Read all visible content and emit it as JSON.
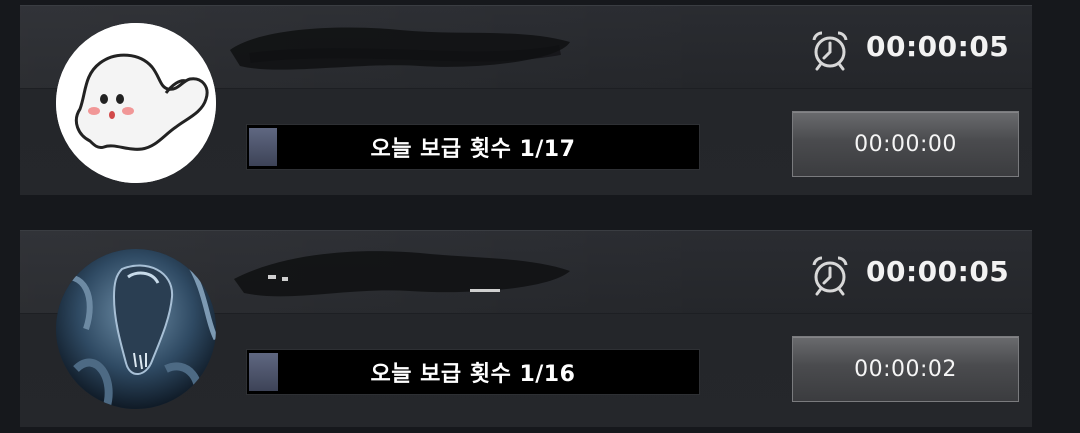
{
  "cards": [
    {
      "avatar": "ghost-avatar",
      "timer": "00:00:05",
      "progress_label": "오늘 보급 횟수 1/17",
      "progress_fraction": 0.059,
      "button_time": "00:00:00"
    },
    {
      "avatar": "alien-avatar",
      "timer": "00:00:05",
      "progress_label": "오늘 보급 횟수 1/16",
      "progress_fraction": 0.0625,
      "button_time": "00:00:02"
    }
  ],
  "icons": {
    "alarm": "alarm-clock-icon"
  },
  "colors": {
    "background": "#16181c",
    "card": "#26282c",
    "progress_fill": "#5a6279",
    "progress_track": "#000000",
    "button": "#4a4b4e"
  }
}
